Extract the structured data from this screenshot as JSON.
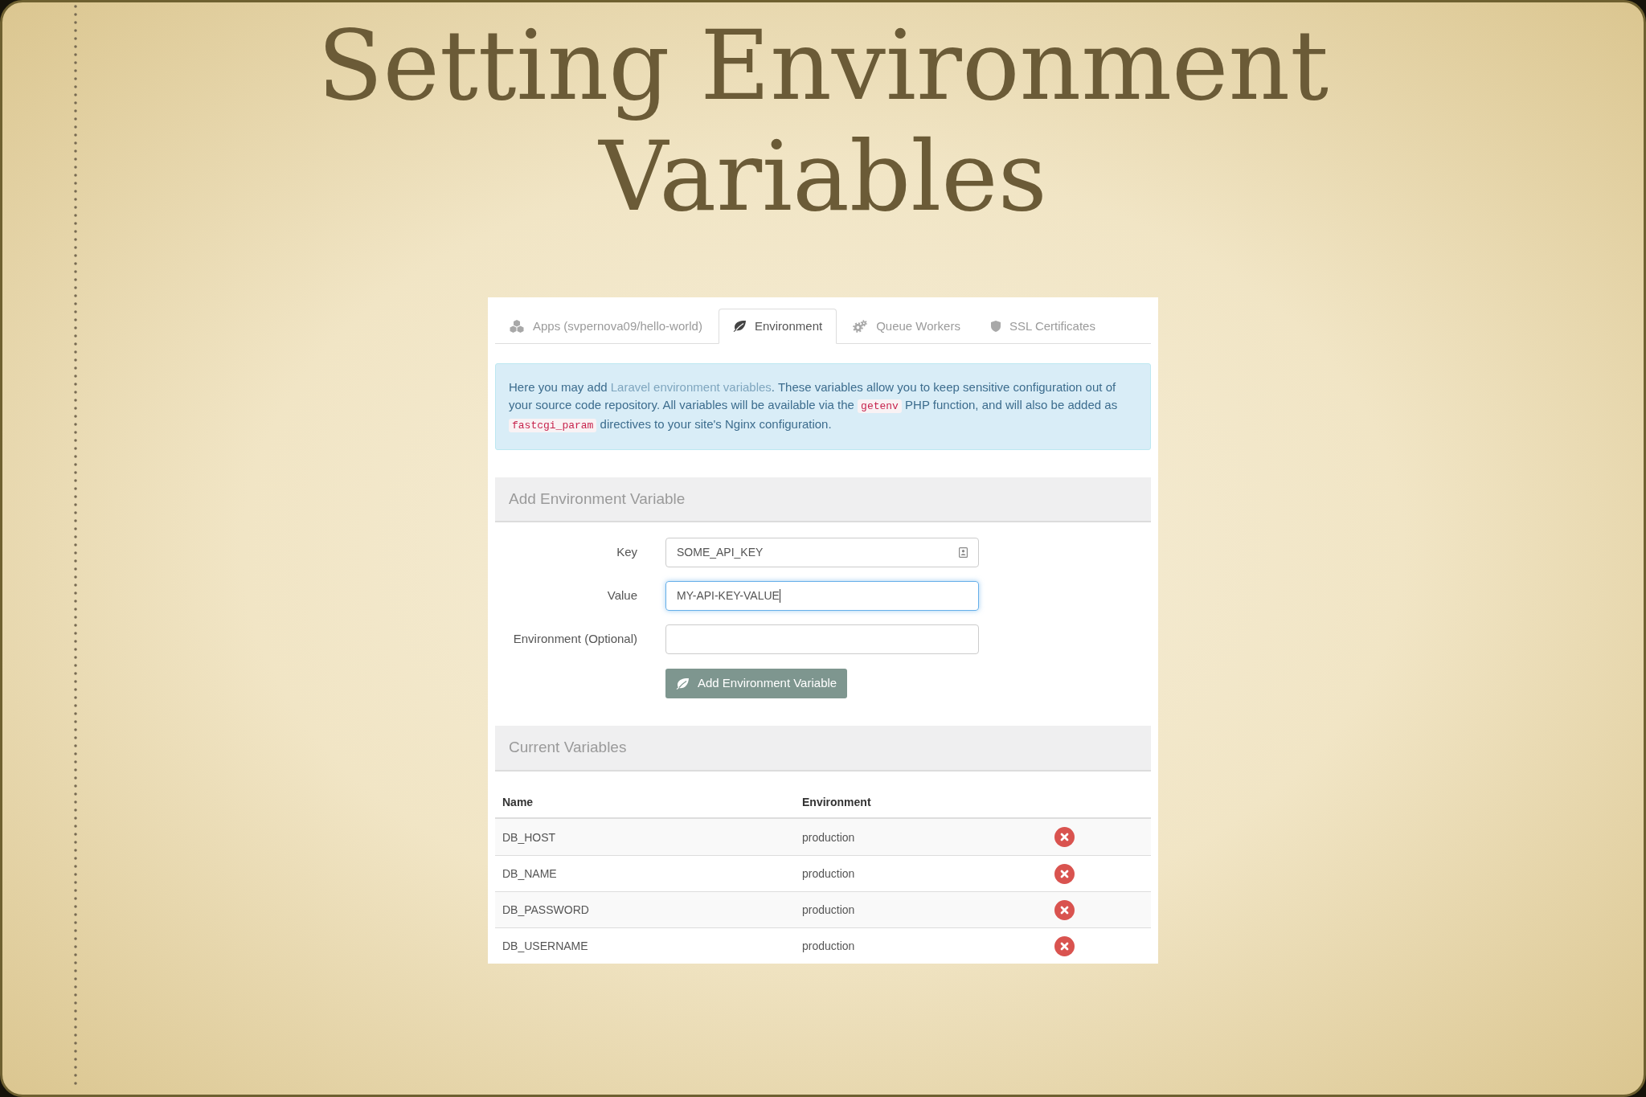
{
  "slide": {
    "title": "Setting Environment Variables"
  },
  "tabs": [
    {
      "label": "Apps (svpernova09/hello-world)",
      "selected": false
    },
    {
      "label": "Environment",
      "selected": true
    },
    {
      "label": "Queue Workers",
      "selected": false
    },
    {
      "label": "SSL Certificates",
      "selected": false
    }
  ],
  "info": {
    "segments": [
      {
        "kind": "text",
        "text": "Here you may add "
      },
      {
        "kind": "link",
        "text": "Laravel environment variables"
      },
      {
        "kind": "text",
        "text": ". These variables allow you to keep sensitive configuration out of your source code repository. All variables will be available via the "
      },
      {
        "kind": "code",
        "text": "getenv"
      },
      {
        "kind": "text",
        "text": " PHP function, and will also be added as "
      },
      {
        "kind": "code",
        "text": "fastcgi_param"
      },
      {
        "kind": "text",
        "text": " directives to your site's Nginx configuration."
      }
    ]
  },
  "add_form": {
    "title": "Add Environment Variable",
    "fields": [
      {
        "label": "Key",
        "value": "SOME_API_KEY",
        "focused": false,
        "autofill": true
      },
      {
        "label": "Value",
        "value": "MY-API-KEY-VALUE",
        "focused": true,
        "autofill": false
      },
      {
        "label": "Environment (Optional)",
        "focused": false,
        "autofill": false
      }
    ],
    "button": {
      "label": "Add Environment Variable"
    }
  },
  "current_variables": {
    "title": "Current Variables",
    "table": {
      "columns": [
        "Name",
        "Environment"
      ],
      "rows": [
        {
          "name": "DB_HOST",
          "environment": "production"
        },
        {
          "name": "DB_NAME",
          "environment": "production"
        },
        {
          "name": "DB_PASSWORD",
          "environment": "production"
        },
        {
          "name": "DB_USERNAME",
          "environment": "production"
        }
      ]
    }
  }
}
